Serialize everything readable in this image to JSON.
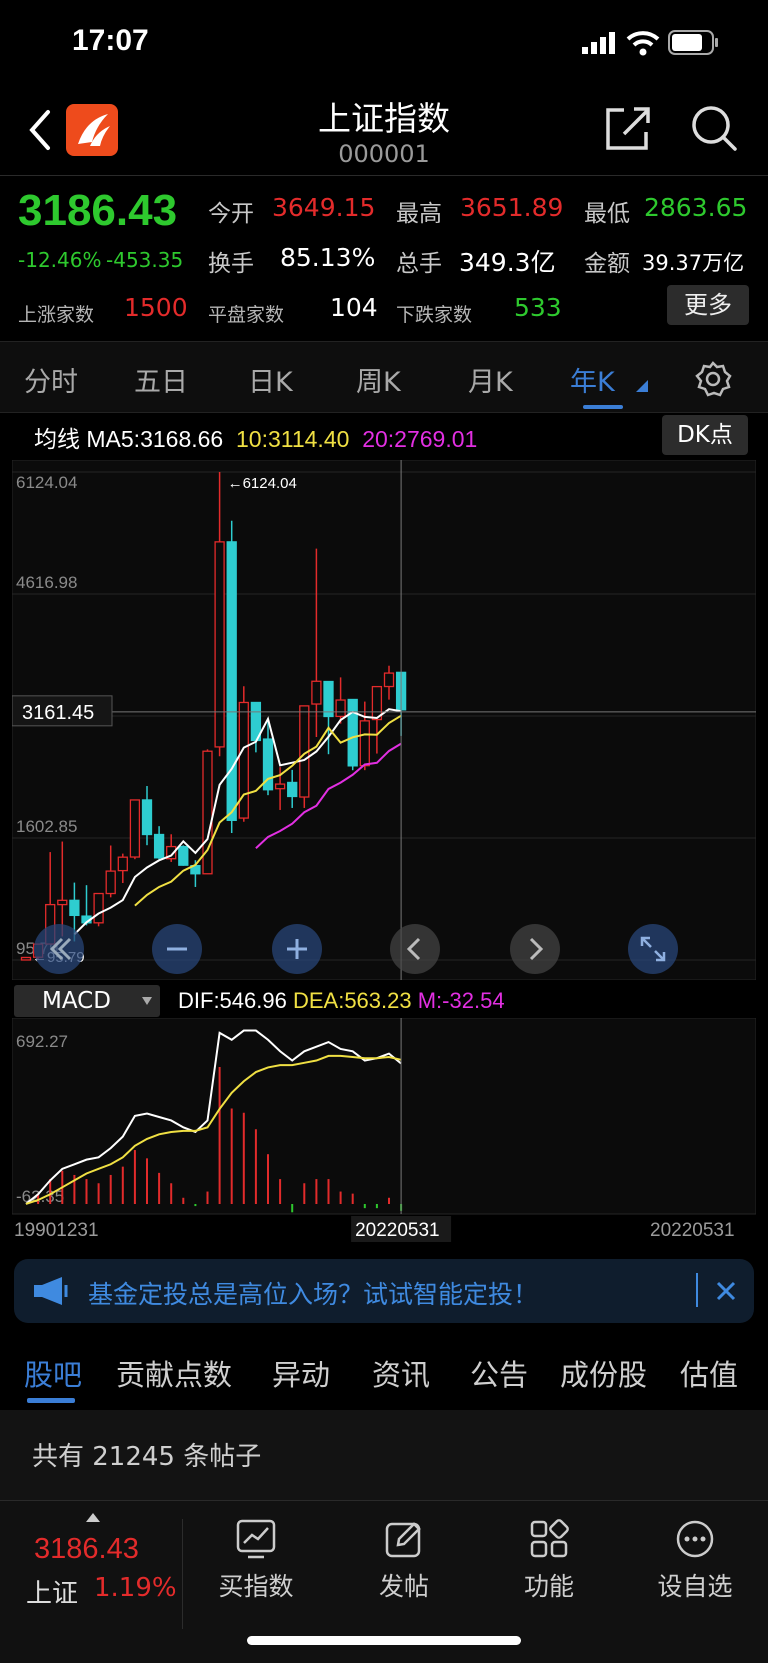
{
  "status_bar": {
    "time": "17:07"
  },
  "header": {
    "title": "上证指数",
    "code": "000001"
  },
  "quote": {
    "price": "3186.43",
    "change_pct": "-12.46%",
    "change_abs": "-453.35",
    "stats": [
      {
        "label": "今开",
        "value": "3649.15",
        "color": "red"
      },
      {
        "label": "最高",
        "value": "3651.89",
        "color": "red"
      },
      {
        "label": "最低",
        "value": "2863.65",
        "color": "green"
      },
      {
        "label": "换手",
        "value": "85.13%",
        "color": "white"
      },
      {
        "label": "总手",
        "value": "349.3亿",
        "color": "white"
      },
      {
        "label": "金额",
        "value": "39.37万亿",
        "color": "white"
      }
    ],
    "breadth": [
      {
        "label": "上涨家数",
        "value": "1500",
        "color": "red"
      },
      {
        "label": "平盘家数",
        "value": "104",
        "color": "white"
      },
      {
        "label": "下跌家数",
        "value": "533",
        "color": "green"
      }
    ],
    "more_label": "更多"
  },
  "period_tabs": [
    "分时",
    "五日",
    "日K",
    "周K",
    "月K",
    "年K"
  ],
  "active_period": "年K",
  "ma_legend": {
    "prefix": "均线",
    "ma5": "MA5:3168.66",
    "ma10": "10:3114.40",
    "ma20": "20:2769.01"
  },
  "dk_label": "DK点",
  "chart_data": [
    {
      "type": "candlestick",
      "title": "",
      "y_ticks": [
        "6124.04",
        "4616.98",
        "3109.91",
        "1602.85",
        "95.79"
      ],
      "ylim": [
        95.79,
        6124.04
      ],
      "crosshair_value": "3161.45",
      "max_annotation": "6124.04",
      "min_annotation": "95.79",
      "candles": [
        {
          "o": 96,
          "h": 127,
          "l": 96,
          "c": 127
        },
        {
          "o": 130,
          "h": 292,
          "l": 105,
          "c": 292
        },
        {
          "o": 293,
          "h": 1429,
          "l": 292,
          "c": 780
        },
        {
          "o": 780,
          "h": 1559,
          "l": 387,
          "c": 833
        },
        {
          "o": 833,
          "h": 1052,
          "l": 325,
          "c": 647
        },
        {
          "o": 638,
          "h": 1020,
          "l": 524,
          "c": 555
        },
        {
          "o": 555,
          "h": 918,
          "l": 512,
          "c": 917
        },
        {
          "o": 917,
          "h": 1510,
          "l": 870,
          "c": 1194
        },
        {
          "o": 1200,
          "h": 1410,
          "l": 1047,
          "c": 1366
        },
        {
          "o": 1368,
          "h": 2073,
          "l": 1341,
          "c": 2073
        },
        {
          "o": 2073,
          "h": 2245,
          "l": 1514,
          "c": 1646
        },
        {
          "o": 1646,
          "h": 1749,
          "l": 1339,
          "c": 1358
        },
        {
          "o": 1347,
          "h": 1649,
          "l": 1307,
          "c": 1497
        },
        {
          "o": 1497,
          "h": 1512,
          "l": 1260,
          "c": 1267
        },
        {
          "o": 1261,
          "h": 1329,
          "l": 998,
          "c": 1161
        },
        {
          "o": 1161,
          "h": 2698,
          "l": 1161,
          "c": 2675
        },
        {
          "o": 2728,
          "h": 6124,
          "l": 2612,
          "c": 5261
        },
        {
          "o": 5261,
          "h": 5522,
          "l": 1664,
          "c": 1821
        },
        {
          "o": 1849,
          "h": 3478,
          "l": 1803,
          "c": 3277
        },
        {
          "o": 3277,
          "h": 3186,
          "l": 2661,
          "c": 2808
        },
        {
          "o": 2825,
          "h": 3067,
          "l": 2132,
          "c": 2199
        },
        {
          "o": 2212,
          "h": 2478,
          "l": 1949,
          "c": 2269
        },
        {
          "o": 2289,
          "h": 2444,
          "l": 1974,
          "c": 2116
        },
        {
          "o": 2109,
          "h": 3239,
          "l": 1974,
          "c": 3235
        },
        {
          "o": 3258,
          "h": 5178,
          "l": 2850,
          "c": 3539
        },
        {
          "o": 3536,
          "h": 3538,
          "l": 2638,
          "c": 3104
        },
        {
          "o": 3105,
          "h": 3587,
          "l": 3016,
          "c": 3307
        },
        {
          "o": 3314,
          "h": 3288,
          "l": 2440,
          "c": 2494
        },
        {
          "o": 2497,
          "h": 3288,
          "l": 2441,
          "c": 3050
        },
        {
          "o": 3066,
          "h": 3474,
          "l": 2646,
          "c": 3473
        },
        {
          "o": 3474,
          "h": 3731,
          "l": 3312,
          "c": 3640
        },
        {
          "o": 3649,
          "h": 3652,
          "l": 2864,
          "c": 3186
        }
      ],
      "ma5": [
        null,
        null,
        null,
        null,
        413,
        562,
        670,
        743,
        836,
        1121,
        1239,
        1327,
        1386,
        1562,
        1418,
        1590,
        2260,
        2457,
        2719,
        2792,
        3075,
        2501,
        2533,
        2567,
        2672,
        2853,
        3060,
        3160,
        3099,
        3086,
        3194,
        3169
      ],
      "ma10": [
        null,
        null,
        null,
        null,
        null,
        null,
        null,
        null,
        null,
        767,
        900,
        998,
        1064,
        1199,
        1270,
        1455,
        1794,
        1921,
        2140,
        2185,
        2333,
        2380,
        2495,
        2643,
        2732,
        2964,
        2781,
        2847,
        2883,
        2879,
        3023,
        3114
      ],
      "ma20": [
        null,
        null,
        null,
        null,
        null,
        null,
        null,
        null,
        null,
        null,
        null,
        null,
        null,
        null,
        null,
        null,
        null,
        null,
        null,
        1476,
        1616,
        1689,
        1779,
        1921,
        2001,
        2209,
        2287,
        2384,
        2511,
        2532,
        2678,
        2769
      ]
    },
    {
      "type": "bar+line",
      "title": "MACD",
      "dif": "DIF:546.96",
      "dea": "DEA:563.23",
      "m": "M:-32.54",
      "y_ticks": [
        "692.27",
        "-62.35"
      ],
      "ylim": [
        -62.35,
        692.27
      ],
      "dif_values": [
        -62,
        -20,
        40,
        90,
        110,
        130,
        140,
        180,
        230,
        320,
        330,
        315,
        300,
        270,
        250,
        300,
        680,
        650,
        690,
        690,
        650,
        600,
        560,
        600,
        620,
        640,
        610,
        600,
        560,
        570,
        590,
        547
      ],
      "dea_values": [
        -62,
        -45,
        -20,
        10,
        40,
        70,
        90,
        110,
        140,
        190,
        220,
        240,
        250,
        255,
        255,
        270,
        350,
        420,
        470,
        510,
        530,
        540,
        540,
        550,
        560,
        580,
        580,
        575,
        570,
        570,
        575,
        563
      ],
      "m_values": [
        0,
        50,
        120,
        160,
        140,
        120,
        100,
        140,
        180,
        260,
        220,
        150,
        100,
        30,
        -10,
        60,
        660,
        460,
        440,
        360,
        240,
        120,
        -40,
        100,
        120,
        120,
        60,
        50,
        -20,
        -20,
        30,
        -33
      ],
      "x_labels": [
        "19901231",
        "20220531",
        "20220531"
      ]
    }
  ],
  "chart_controls": [
    "rewind-icon",
    "zoom-out-icon",
    "zoom-in-icon",
    "prev-icon",
    "next-icon",
    "expand-icon"
  ],
  "ad_banner": {
    "text": "基金定投总是高位入场？试试智能定投！"
  },
  "content_tabs": [
    "股吧",
    "贡献点数",
    "异动",
    "资讯",
    "公告",
    "成份股",
    "估值"
  ],
  "posts_count_text": "共有 21245 条帖子",
  "dock": {
    "ticker_price": "3186.43",
    "ticker_name": "上证",
    "ticker_change": "1.19%",
    "buttons": [
      "买指数",
      "发帖",
      "功能",
      "设自选"
    ]
  },
  "colors": {
    "up": "#e32b2b",
    "down": "#2ecdd0",
    "green": "#2ec92e",
    "accent": "#3b7ed6",
    "ma5": "#ffffff",
    "ma10": "#f0e043",
    "ma20": "#e22fe2"
  }
}
